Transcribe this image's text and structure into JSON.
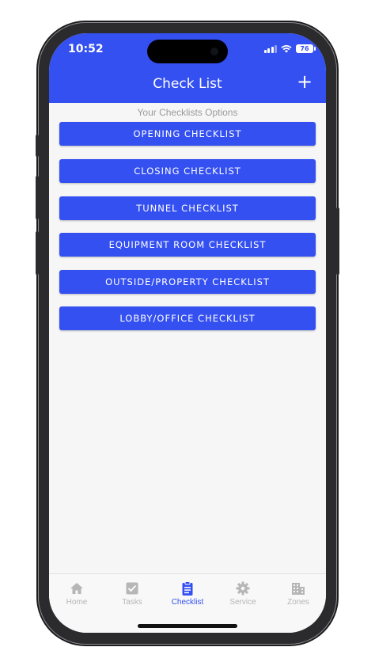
{
  "status": {
    "time": "10:52",
    "battery": "76"
  },
  "header": {
    "title": "Check List",
    "add_label": "+"
  },
  "subtitle": "Your Checklists Options",
  "checklists": [
    {
      "label": "OPENING CHECKLIST"
    },
    {
      "label": "CLOSING CHECKLIST"
    },
    {
      "label": "TUNNEL CHECKLIST"
    },
    {
      "label": "EQUIPMENT ROOM CHECKLIST"
    },
    {
      "label": "OUTSIDE/PROPERTY CHECKLIST"
    },
    {
      "label": "LOBBY/OFFICE CHECKLIST"
    }
  ],
  "tabs": [
    {
      "label": "Home",
      "icon": "home-icon"
    },
    {
      "label": "Tasks",
      "icon": "checkbox-icon"
    },
    {
      "label": "Checklist",
      "icon": "clipboard-icon",
      "active": true
    },
    {
      "label": "Service",
      "icon": "gear-icon"
    },
    {
      "label": "Zones",
      "icon": "building-icon"
    }
  ],
  "colors": {
    "accent": "#3450f0",
    "inactive_tab": "#b6b6b6",
    "background": "#f6f6f7"
  }
}
